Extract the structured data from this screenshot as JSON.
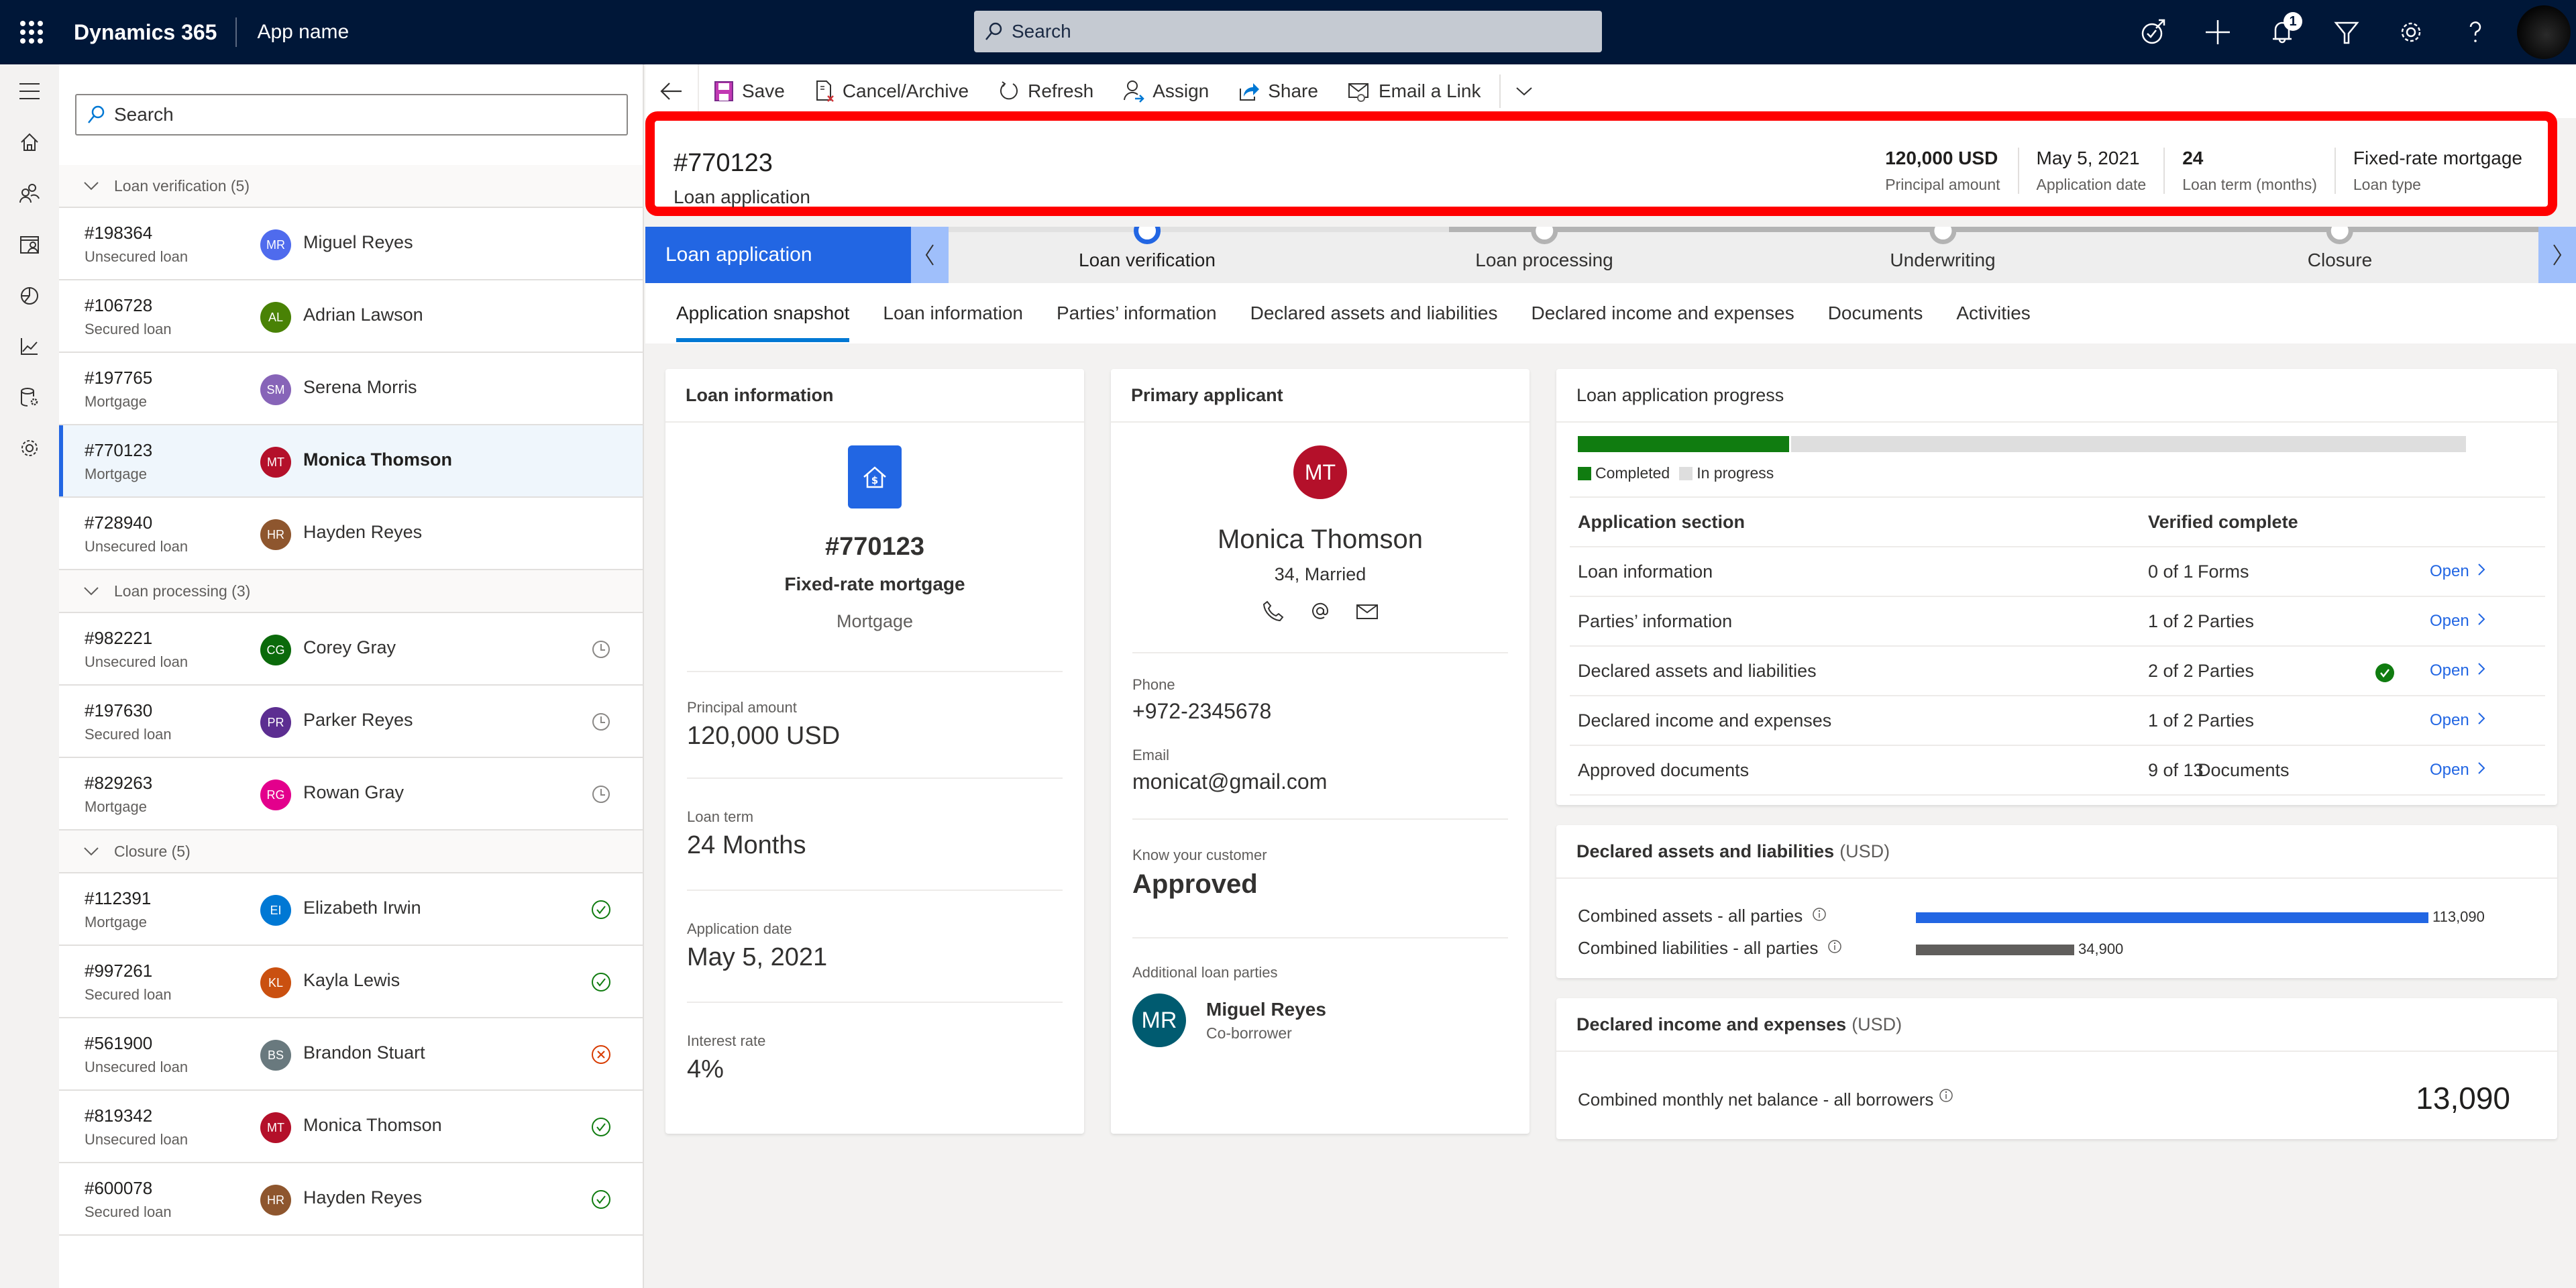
{
  "topbar": {
    "brand": "Dynamics 365",
    "app_name": "App name",
    "search_placeholder": "Search",
    "notification_count": "1",
    "icons": [
      "task-flow-icon",
      "plus-icon",
      "bell-icon",
      "filter-icon",
      "gear-icon",
      "help-icon",
      "user-avatar"
    ]
  },
  "rail": {
    "items": [
      "hamburger-icon",
      "home-icon",
      "people-icon",
      "calendar-people-icon",
      "pie-chart-icon",
      "line-chart-icon",
      "database-settings-icon",
      "gear-icon"
    ]
  },
  "list": {
    "search_placeholder": "Search",
    "groups": [
      {
        "label": "Loan verification (5)",
        "rows": [
          {
            "id": "#198364",
            "type": "Unsecured loan",
            "initials": "MR",
            "name": "Miguel Reyes",
            "color": "#4f6bed",
            "status": ""
          },
          {
            "id": "#106728",
            "type": "Secured loan",
            "initials": "AL",
            "name": "Adrian Lawson",
            "color": "#498205",
            "status": ""
          },
          {
            "id": "#197765",
            "type": "Mortgage",
            "initials": "SM",
            "name": "Serena Morris",
            "color": "#8764b8",
            "status": ""
          },
          {
            "id": "#770123",
            "type": "Mortgage",
            "initials": "MT",
            "name": "Monica Thomson",
            "color": "#b4102a",
            "status": "",
            "selected": true
          },
          {
            "id": "#728940",
            "type": "Unsecured loan",
            "initials": "HR",
            "name": "Hayden Reyes",
            "color": "#8e562e",
            "status": ""
          }
        ]
      },
      {
        "label": "Loan processing (3)",
        "rows": [
          {
            "id": "#982221",
            "type": "Unsecured loan",
            "initials": "CG",
            "name": "Corey Gray",
            "color": "#0b6a0b",
            "status": "pending"
          },
          {
            "id": "#197630",
            "type": "Secured loan",
            "initials": "PR",
            "name": "Parker Reyes",
            "color": "#5c2e91",
            "status": "pending"
          },
          {
            "id": "#829263",
            "type": "Mortgage",
            "initials": "RG",
            "name": "Rowan Gray",
            "color": "#e3008c",
            "status": "pending"
          }
        ]
      },
      {
        "label": "Closure (5)",
        "rows": [
          {
            "id": "#112391",
            "type": "Mortgage",
            "initials": "EI",
            "name": "Elizabeth Irwin",
            "color": "#0078d4",
            "status": "approved"
          },
          {
            "id": "#997261",
            "type": "Secured loan",
            "initials": "KL",
            "name": "Kayla Lewis",
            "color": "#ca5010",
            "status": "approved"
          },
          {
            "id": "#561900",
            "type": "Unsecured loan",
            "initials": "BS",
            "name": "Brandon Stuart",
            "color": "#69797e",
            "status": "rejected"
          },
          {
            "id": "#819342",
            "type": "Unsecured loan",
            "initials": "MT",
            "name": "Monica Thomson",
            "color": "#b4102a",
            "status": "approved"
          },
          {
            "id": "#600078",
            "type": "Secured loan",
            "initials": "HR",
            "name": "Hayden Reyes",
            "color": "#8e562e",
            "status": "approved"
          }
        ]
      }
    ]
  },
  "commands": {
    "back": "back-arrow-icon",
    "items": [
      {
        "label": "Save",
        "icon": "save-icon"
      },
      {
        "label": "Cancel/Archive",
        "icon": "cancel-archive-icon"
      },
      {
        "label": "Refresh",
        "icon": "refresh-icon"
      },
      {
        "label": "Assign",
        "icon": "assign-icon"
      },
      {
        "label": "Share",
        "icon": "share-icon"
      },
      {
        "label": "Email a Link",
        "icon": "email-link-icon"
      }
    ],
    "more": "chevron-down-icon"
  },
  "header": {
    "title": "#770123",
    "subtitle": "Loan application",
    "fields": [
      {
        "value": "120,000 USD",
        "label": "Principal amount",
        "bold": true
      },
      {
        "value": "May 5, 2021",
        "label": "Application date",
        "bold": false
      },
      {
        "value": "24",
        "label": "Loan term (months)",
        "bold": true
      },
      {
        "value": "Fixed-rate mortgage",
        "label": "Loan type",
        "bold": false
      }
    ],
    "highlight_color": "#ff0000"
  },
  "bpf": {
    "active_label": "Loan application",
    "stages": [
      {
        "label": "Loan verification",
        "active": true
      },
      {
        "label": "Loan processing",
        "active": false
      },
      {
        "label": "Underwriting",
        "active": false
      },
      {
        "label": "Closure",
        "active": false
      }
    ]
  },
  "tabs": [
    {
      "label": "Application snapshot",
      "active": true
    },
    {
      "label": "Loan information",
      "active": false
    },
    {
      "label": "Parties’ information",
      "active": false
    },
    {
      "label": "Declared assets and liabilities",
      "active": false
    },
    {
      "label": "Declared income and expenses",
      "active": false
    },
    {
      "label": "Documents",
      "active": false
    },
    {
      "label": "Activities",
      "active": false
    }
  ],
  "loan_card": {
    "title": "Loan information",
    "icon": "house-dollar-icon",
    "number": "#770123",
    "product": "Fixed-rate mortgage",
    "category": "Mortgage",
    "fields": [
      {
        "label": "Principal amount",
        "value": "120,000 USD"
      },
      {
        "label": "Loan term",
        "value": "24 Months"
      },
      {
        "label": "Application date",
        "value": "May 5, 2021"
      },
      {
        "label": "Interest rate",
        "value": "4%"
      }
    ]
  },
  "applicant_card": {
    "title": "Primary applicant",
    "initials": "MT",
    "name": "Monica Thomson",
    "details": "34, Married",
    "phone_label": "Phone",
    "phone": "+972-2345678",
    "email_label": "Email",
    "email": "monicat@gmail.com",
    "kyc_label": "Know your customer",
    "kyc_value": "Approved",
    "parties_label": "Additional loan parties",
    "party": {
      "initials": "MR",
      "name": "Miguel Reyes",
      "role": "Co-borrower"
    }
  },
  "progress_card": {
    "title": "Loan application progress",
    "completed_fraction": 0.24,
    "legend_completed": "Completed",
    "legend_in_progress": "In progress",
    "col_section": "Application section",
    "col_verified": "Verified complete",
    "open_label": "Open",
    "rows": [
      {
        "section": "Loan information",
        "verified": "0 of 1",
        "unit": "Forms",
        "complete": false
      },
      {
        "section": "Parties’ information",
        "verified": "1 of 2",
        "unit": "Parties",
        "complete": false
      },
      {
        "section": "Declared assets and liabilities",
        "verified": "2 of 2",
        "unit": "Parties",
        "complete": true
      },
      {
        "section": "Declared income and expenses",
        "verified": "1 of 2",
        "unit": "Parties",
        "complete": false
      },
      {
        "section": "Approved documents",
        "verified": "9 of 13",
        "unit": "Documents",
        "complete": false
      }
    ]
  },
  "assets_card": {
    "title": "Declared assets and liabilities",
    "unit": "(USD)",
    "rows": [
      {
        "label": "Combined assets - all parties",
        "value": 113090,
        "display": "113,090",
        "color": "#2266e3"
      },
      {
        "label": "Combined liabilities - all parties",
        "value": 34900,
        "display": "34,900",
        "color": "#605e5c"
      }
    ]
  },
  "income_card": {
    "title": "Declared income and expenses",
    "unit": "(USD)",
    "label": "Combined monthly net balance - all borrowers",
    "value": "13,090"
  }
}
